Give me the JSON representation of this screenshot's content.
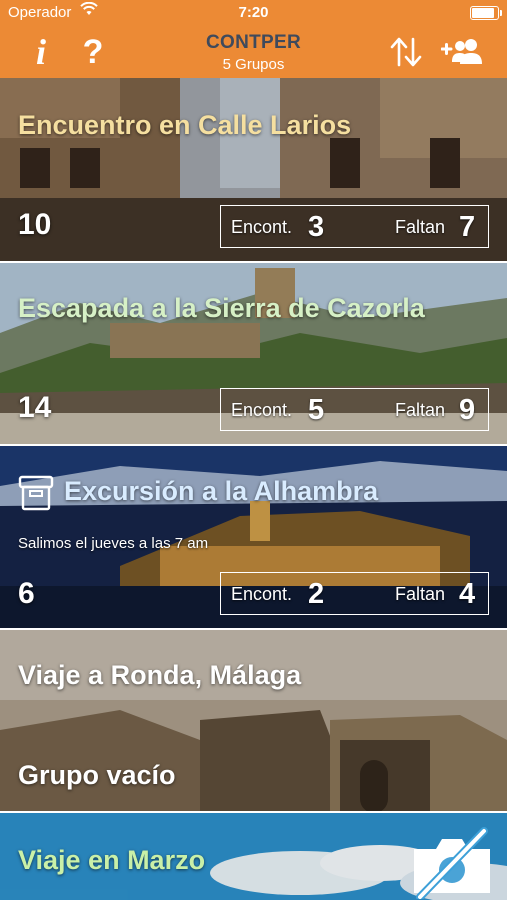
{
  "status_bar": {
    "carrier": "Operador",
    "time": "7:20",
    "battery_level": 1.0
  },
  "nav": {
    "title": "CONTPER",
    "subtitle": "5 Grupos",
    "info_icon": "i",
    "help_icon": "?",
    "sort_icon": "sort-arrows-icon",
    "add_icon": "add-group-icon"
  },
  "groups": [
    {
      "title": "Encuentro en Calle Larios",
      "title_color": "#f5dfa0",
      "total": "10",
      "encont_label": "Encont.",
      "encont": "3",
      "faltan_label": "Faltan",
      "faltan": "7"
    },
    {
      "title": "Escapada a la Sierra de Cazorla",
      "title_color": "#d6f0c6",
      "total": "14",
      "encont_label": "Encont.",
      "encont": "5",
      "faltan_label": "Faltan",
      "faltan": "9"
    },
    {
      "title": "Excursión a la Alhambra",
      "title_color": "#d9ecff",
      "note": "Salimos el jueves a las 7 am",
      "total": "6",
      "encont_label": "Encont.",
      "encont": "2",
      "faltan_label": "Faltan",
      "faltan": "4",
      "icon": "archive-box-icon"
    },
    {
      "title": "Viaje a Ronda, Málaga",
      "title_color": "#ffffff",
      "secondary": "Grupo vacío"
    },
    {
      "title": "Viaje en Marzo",
      "title_color": "#c9f0a8",
      "icon": "no-camera-icon"
    }
  ]
}
